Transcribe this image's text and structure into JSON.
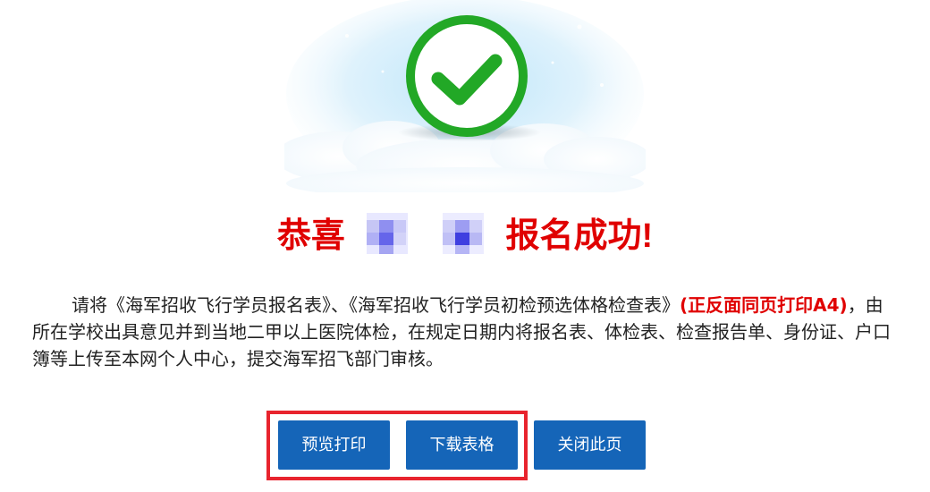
{
  "success": {
    "icon": "checkmark-circle-icon",
    "prefix": "恭喜",
    "suffix": "报名成功!"
  },
  "instructions": {
    "text_before": "请将《海军招收飞行学员报名表》、《海军招收飞行学员初检预选体格检查表》",
    "emphasis": "(正反面同页打印A4)",
    "text_after": "，由所在学校出具意见并到当地二甲以上医院体检，在规定日期内将报名表、体检表、检查报告单、身份证、户口簿等上传至本网个人中心，提交海军招飞部门审核。"
  },
  "buttons": {
    "preview_print": "预览打印",
    "download_form": "下载表格",
    "close_page": "关闭此页"
  },
  "colors": {
    "title_red": "#e00000",
    "button_blue": "#1565b8",
    "highlight_red": "#e8242e",
    "check_green": "#22a826"
  }
}
